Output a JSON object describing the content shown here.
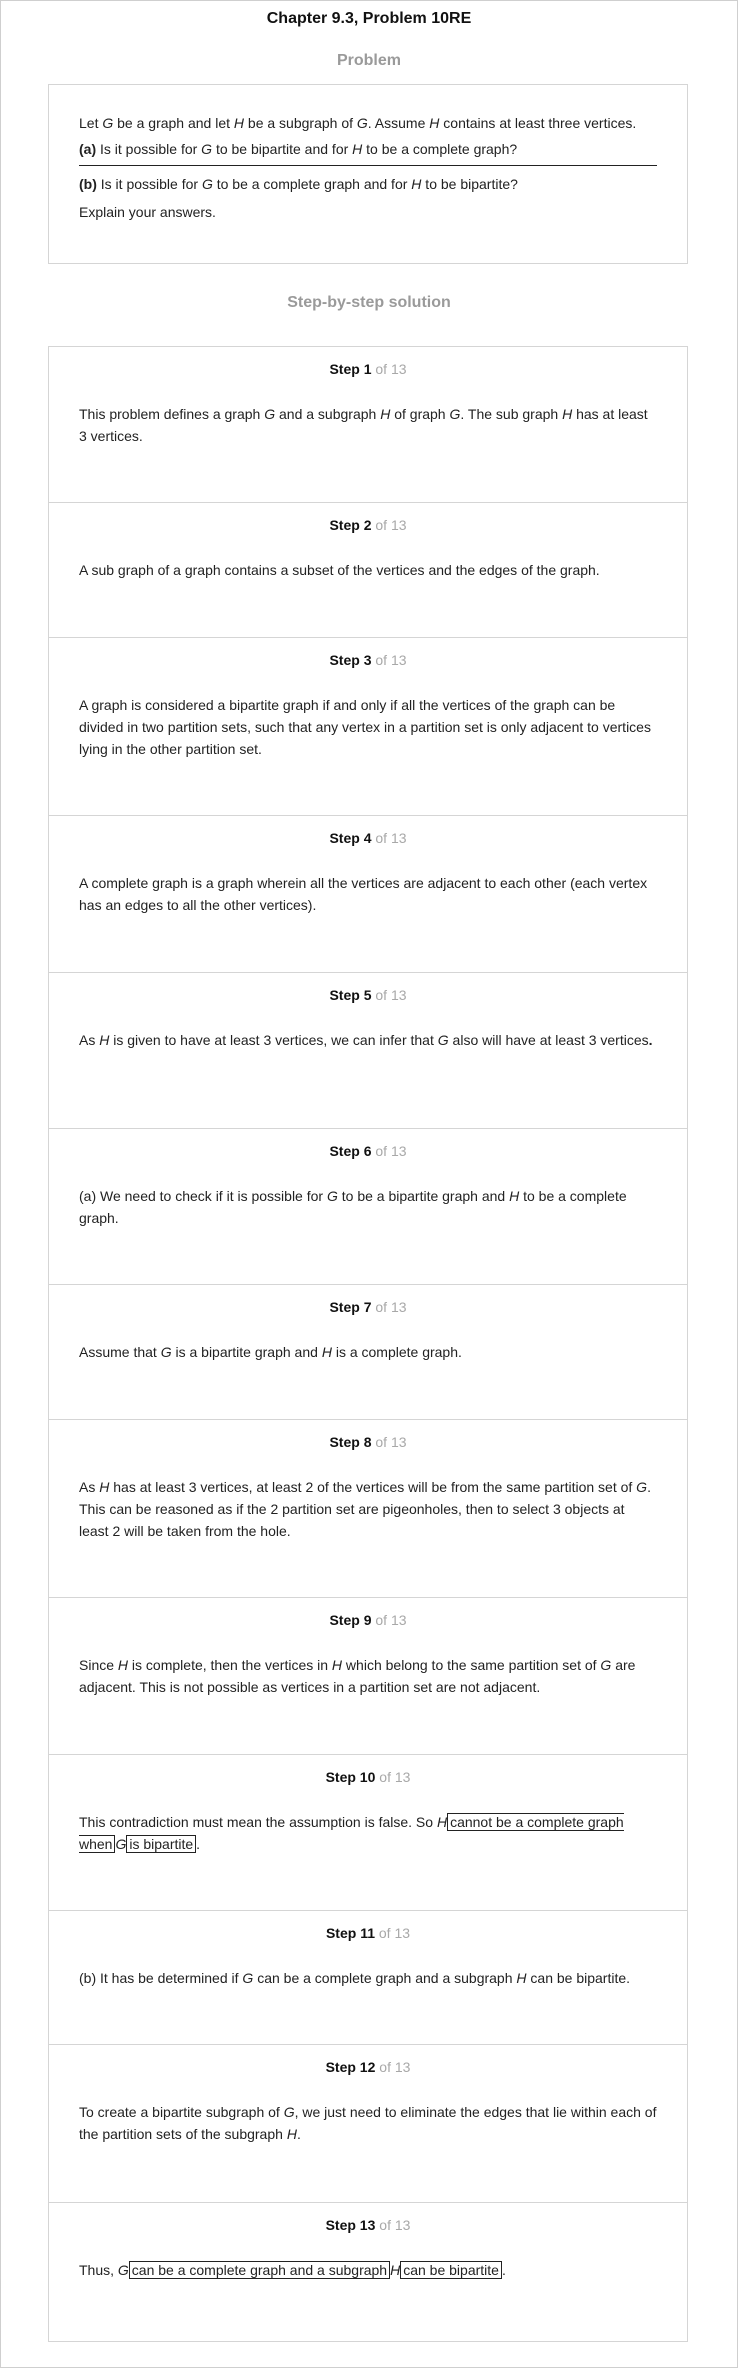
{
  "title": "Chapter 9.3, Problem 10RE",
  "problem_heading": "Problem",
  "problem": {
    "line1": [
      "Let ",
      "G",
      " be a graph and let ",
      "H",
      " be a subgraph of ",
      "G",
      ". Assume ",
      "H",
      " contains at least three vertices."
    ],
    "line2_label": "(a)",
    "line2": [
      " Is it possible for ",
      "G",
      " to be bipartite and for ",
      "H",
      " to be a complete graph?"
    ],
    "line3_label": "(b)",
    "line3": [
      " Is it possible for ",
      "G",
      " to be a complete graph and for ",
      "H",
      " to be bipartite?"
    ],
    "line4": "Explain your answers."
  },
  "solution_heading": "Step-by-step solution",
  "step_word": "Step",
  "of_text": "of 13",
  "steps": [
    {
      "n": "1",
      "segs": [
        "This problem defines a graph ",
        "G",
        " and a subgraph ",
        "H",
        " of graph ",
        "G",
        ". The sub graph ",
        "H",
        " has at least 3 vertices."
      ]
    },
    {
      "n": "2",
      "segs": [
        "A sub graph of a graph contains a subset of the vertices and the edges of the graph."
      ]
    },
    {
      "n": "3",
      "segs": [
        "A graph is considered a bipartite graph if and only if all the vertices of the graph can be divided in two partition sets, such that any vertex in a partition set is only adjacent to vertices lying in the other partition set."
      ]
    },
    {
      "n": "4",
      "segs": [
        "A complete graph is a graph wherein all the vertices are adjacent to each other (each vertex has an edges to all the other vertices)."
      ]
    },
    {
      "n": "5",
      "segs": [
        "As ",
        "H",
        " is given to have at least 3 vertices, we can infer that ",
        "G",
        " also will have at least 3 vertices",
        "."
      ]
    },
    {
      "n": "6",
      "segs": [
        "(a) We need to check if it is possible for ",
        "G",
        " to be a bipartite graph and ",
        "H",
        " to be a complete graph."
      ]
    },
    {
      "n": "7",
      "segs": [
        "Assume that ",
        "G",
        " is a bipartite graph and ",
        "H",
        " is a complete graph."
      ]
    },
    {
      "n": "8",
      "segs": [
        "As ",
        "H",
        " has at least 3 vertices, at least 2 of the vertices will be from the same partition set of ",
        "G",
        ". This can be reasoned as if the 2 partition set are pigeonholes, then to select 3 objects at least 2 will be taken from the hole."
      ]
    },
    {
      "n": "9",
      "segs": [
        "Since ",
        "H",
        " is complete, then the vertices in ",
        "H",
        " which belong to the same partition set of ",
        "G",
        " are adjacent. This is not possible as vertices in a partition set are not adjacent."
      ]
    },
    {
      "n": "10",
      "segs": [
        "This contradiction must mean the assumption is false. So ",
        "H",
        "cannot be a complete graph when",
        "G",
        "is bipartite",
        "."
      ]
    },
    {
      "n": "11",
      "segs": [
        "(b) It has be determined if ",
        "G",
        " can be a complete graph and a subgraph ",
        "H",
        " can be bipartite."
      ]
    },
    {
      "n": "12",
      "segs": [
        "To create a bipartite subgraph of ",
        "G",
        ", we just need to eliminate the edges that lie within each of the partition sets of the subgraph ",
        "H",
        "."
      ]
    },
    {
      "n": "13",
      "segs": [
        "Thus, ",
        "G",
        "can be a complete graph and a subgraph",
        "H",
        "can be bipartite",
        "."
      ]
    }
  ]
}
